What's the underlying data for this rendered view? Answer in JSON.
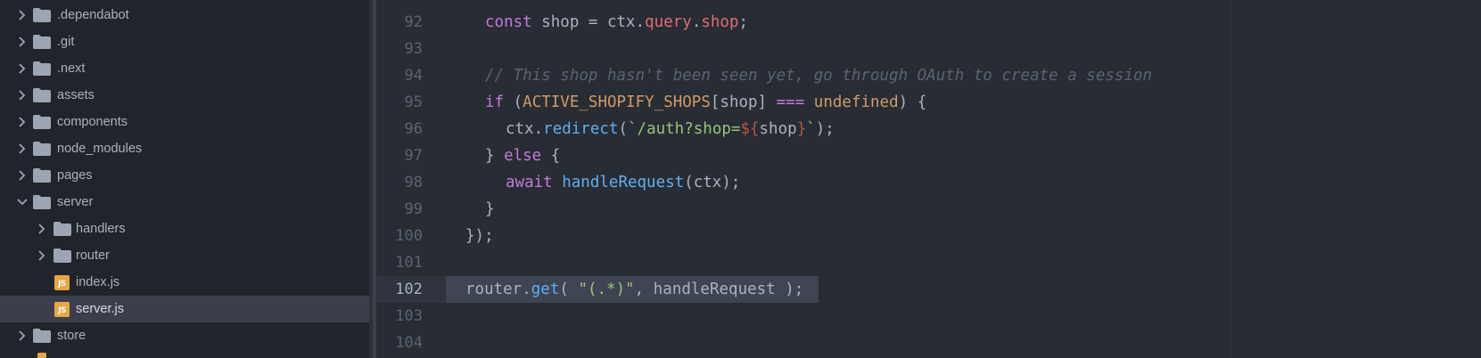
{
  "tree": {
    "items": [
      {
        "label": ".dependabot",
        "type": "folder",
        "expanded": false
      },
      {
        "label": ".git",
        "type": "folder",
        "expanded": false
      },
      {
        "label": ".next",
        "type": "folder",
        "expanded": false
      },
      {
        "label": "assets",
        "type": "folder",
        "expanded": false
      },
      {
        "label": "components",
        "type": "folder",
        "expanded": false
      },
      {
        "label": "node_modules",
        "type": "folder",
        "expanded": false
      },
      {
        "label": "pages",
        "type": "folder",
        "expanded": false
      },
      {
        "label": "server",
        "type": "folder",
        "expanded": true
      },
      {
        "label": "handlers",
        "type": "folder",
        "expanded": false
      },
      {
        "label": "router",
        "type": "folder",
        "expanded": false
      },
      {
        "label": "index.js",
        "type": "file",
        "icon_text": "JS"
      },
      {
        "label": "server.js",
        "type": "file",
        "icon_text": "JS",
        "selected": true
      },
      {
        "label": "store",
        "type": "folder",
        "expanded": false
      }
    ]
  },
  "editor": {
    "lines": [
      {
        "num": "92"
      },
      {
        "num": "93"
      },
      {
        "num": "94"
      },
      {
        "num": "95"
      },
      {
        "num": "96"
      },
      {
        "num": "97"
      },
      {
        "num": "98"
      },
      {
        "num": "99"
      },
      {
        "num": "100"
      },
      {
        "num": "101"
      },
      {
        "num": "102",
        "current": true
      },
      {
        "num": "103"
      },
      {
        "num": "104"
      }
    ],
    "code": {
      "l92": [
        "const",
        " shop = ctx.",
        "query",
        ".",
        "shop",
        ";"
      ],
      "l94": "// This shop hasn't been seen yet, go through OAuth to create a session",
      "l95": [
        "if",
        " (",
        "ACTIVE_SHOPIFY_SHOPS",
        "[shop] ",
        "===",
        " ",
        "undefined",
        ") {"
      ],
      "l96": [
        "ctx.",
        "redirect",
        "(",
        "`/auth?shop=",
        "${",
        "shop",
        "}",
        "`",
        ");"
      ],
      "l97": [
        "} ",
        "else",
        " {"
      ],
      "l98": [
        "await",
        " ",
        "handleRequest",
        "(ctx);"
      ],
      "l99": "}",
      "l100": "});",
      "l102": [
        "router.",
        "get",
        "( ",
        "\"(.*)\"",
        ", handleRequest );"
      ]
    }
  },
  "colors": {
    "sidebar_bg": "#21252b",
    "editor_bg": "#282c34",
    "selection": "#3e4451",
    "keyword": "#c678dd",
    "function": "#61afef",
    "string": "#98c379",
    "comment": "#5c6370",
    "constant": "#e5c07b",
    "js_icon": "#e5a643"
  }
}
